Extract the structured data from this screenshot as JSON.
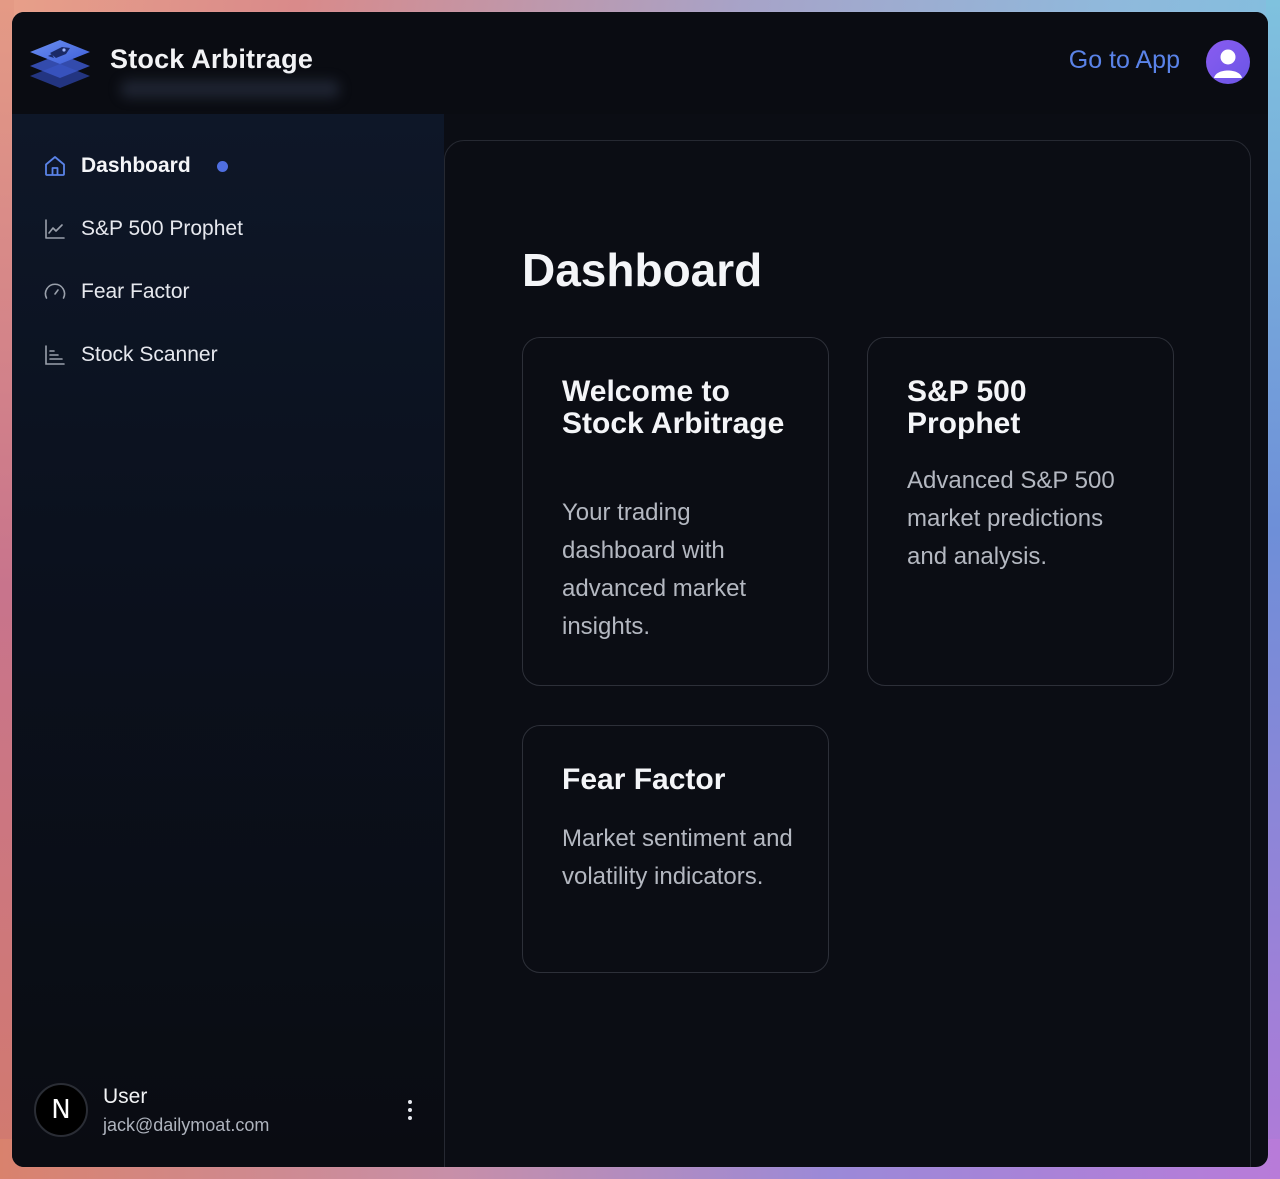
{
  "app": {
    "brand": "Stock Arbitrage",
    "go_to_app": "Go to App"
  },
  "sidebar": {
    "items": [
      {
        "label": "Dashboard",
        "icon": "home-icon",
        "active": true
      },
      {
        "label": "S&P 500 Prophet",
        "icon": "line-chart-icon",
        "active": false
      },
      {
        "label": "Fear Factor",
        "icon": "gauge-icon",
        "active": false
      },
      {
        "label": "Stock Scanner",
        "icon": "bar-chart-icon",
        "active": false
      }
    ],
    "user": {
      "avatar_letter": "N",
      "name": "User",
      "email": "jack@dailymoat.com"
    }
  },
  "main": {
    "title": "Dashboard",
    "cards": [
      {
        "title": "Welcome to Stock Arbitrage",
        "description": "Your trading dashboard with advanced market insights."
      },
      {
        "title": "S&P 500 Prophet",
        "description": "Advanced S&P 500 market predictions and analysis."
      },
      {
        "title": "Fear Factor",
        "description": "Market sentiment and volatility indicators."
      }
    ]
  },
  "colors": {
    "accent": "#5a83e8",
    "active_dot": "#4f6ee0",
    "background": "#0b0d14"
  }
}
